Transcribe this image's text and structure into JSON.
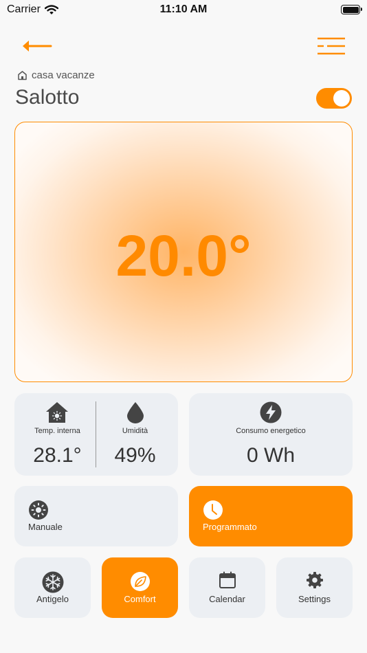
{
  "status_bar": {
    "carrier": "Carrier",
    "time": "11:10 AM"
  },
  "header": {
    "location": "casa vacanze",
    "room": "Salotto",
    "power_on": true
  },
  "thermostat": {
    "setpoint": "20.0°"
  },
  "stats": {
    "internal_temp": {
      "label": "Temp. interna",
      "value": "28.1°"
    },
    "humidity": {
      "label": "Umidità",
      "value": "49%"
    },
    "energy": {
      "label": "Consumo energetico",
      "value": "0 Wh"
    }
  },
  "modes": {
    "manual": {
      "label": "Manuale",
      "active": false
    },
    "scheduled": {
      "label": "Programmato",
      "active": true
    }
  },
  "presets": {
    "antifreeze": {
      "label": "Antigelo",
      "active": false
    },
    "comfort": {
      "label": "Comfort",
      "active": true
    },
    "calendar": {
      "label": "Calendar",
      "active": false
    },
    "settings": {
      "label": "Settings",
      "active": false
    }
  },
  "colors": {
    "accent": "#ff8c00",
    "card": "#eceff3",
    "icon": "#444444",
    "background": "#f8f8f8"
  },
  "icons": {
    "back": "arrow-left-icon",
    "menu": "hamburger-menu-icon",
    "location": "home-icon",
    "internal_temp": "house-sun-icon",
    "humidity": "water-drop-icon",
    "energy": "lightning-bolt-icon",
    "manual": "sun-icon",
    "scheduled": "clock-icon",
    "antifreeze": "snowflake-icon",
    "comfort": "leaf-icon",
    "calendar": "calendar-icon",
    "settings": "gear-icon"
  }
}
